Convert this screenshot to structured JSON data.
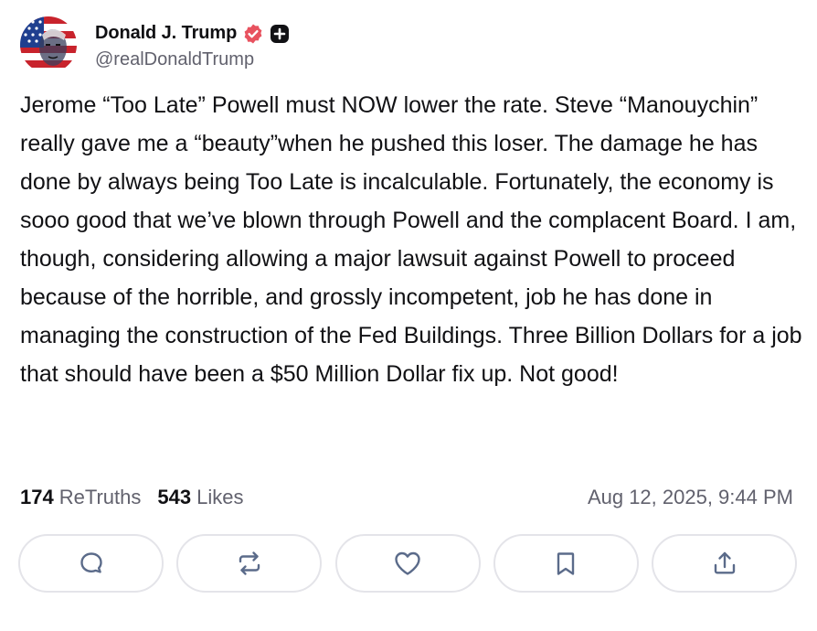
{
  "author": {
    "display_name": "Donald J. Trump",
    "handle": "@realDonaldTrump",
    "avatar_icon": "flag-portrait-avatar",
    "badges": [
      "verified-badge-icon",
      "plus-badge-icon"
    ]
  },
  "post": {
    "text": "Jerome “Too Late” Powell must NOW lower the rate. Steve “Manouychin” really gave me a “beauty”when he pushed this loser. The damage he has done by always being Too Late is incalculable. Fortunately, the economy is sooo good that we’ve blown through Powell and the complacent Board. I am, though, considering allowing a major lawsuit against Powell to proceed because of the horrible, and grossly incompetent, job he has done in managing the construction of the Fed Buildings. Three Billion Dollars for a job that should have been a $50 Million Dollar fix up. Not good!"
  },
  "stats": {
    "retruths_count": "174",
    "retruths_label": "ReTruths",
    "likes_count": "543",
    "likes_label": "Likes",
    "timestamp": "Aug 12, 2025, 9:44 PM"
  },
  "actions": [
    {
      "name": "reply",
      "icon": "comment-icon"
    },
    {
      "name": "retruth",
      "icon": "repost-icon"
    },
    {
      "name": "like",
      "icon": "heart-icon"
    },
    {
      "name": "bookmark",
      "icon": "bookmark-icon"
    },
    {
      "name": "share",
      "icon": "share-icon"
    }
  ],
  "colors": {
    "verified": "#e8525f",
    "muted_text": "#61616d",
    "icon_stroke": "#5b6b8a",
    "border": "#e4e4e9"
  }
}
